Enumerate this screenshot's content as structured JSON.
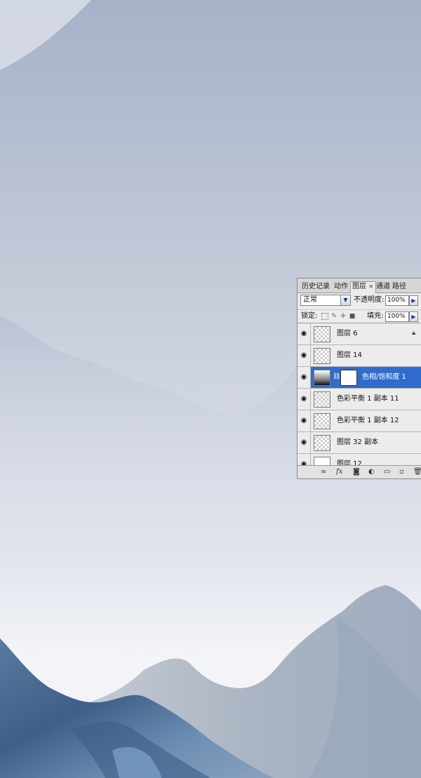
{
  "panel": {
    "tabs": [
      {
        "label": "历史记录"
      },
      {
        "label": "动作"
      },
      {
        "label": "图层",
        "close": "×"
      },
      {
        "label": "通道"
      },
      {
        "label": "路径"
      }
    ],
    "blend_mode": "正常",
    "opacity_label": "不透明度:",
    "opacity_value": "100%",
    "lock_label": "锁定:",
    "fill_label": "填充:",
    "fill_value": "100%",
    "layers": [
      {
        "name": "图层 6",
        "locked": true
      },
      {
        "name": "图层 14"
      },
      {
        "name": "色相/饱和度 1",
        "selected": true
      },
      {
        "name": "色彩平衡 1 副本 11"
      },
      {
        "name": "色彩平衡 1 副本 12"
      },
      {
        "name": "图层 32 副本"
      },
      {
        "name": "图层 12"
      }
    ]
  },
  "colors": {
    "sky_top": "#a9b4c9",
    "sky_bottom": "#f3f4f7",
    "mountain_blue": "#4f6f95",
    "mountain_gray": "#a7b3c3",
    "selection": "#2f6ccd"
  },
  "icons": {
    "visibility": "eye-icon",
    "link": "chain-icon",
    "lock": "lock-icon"
  }
}
